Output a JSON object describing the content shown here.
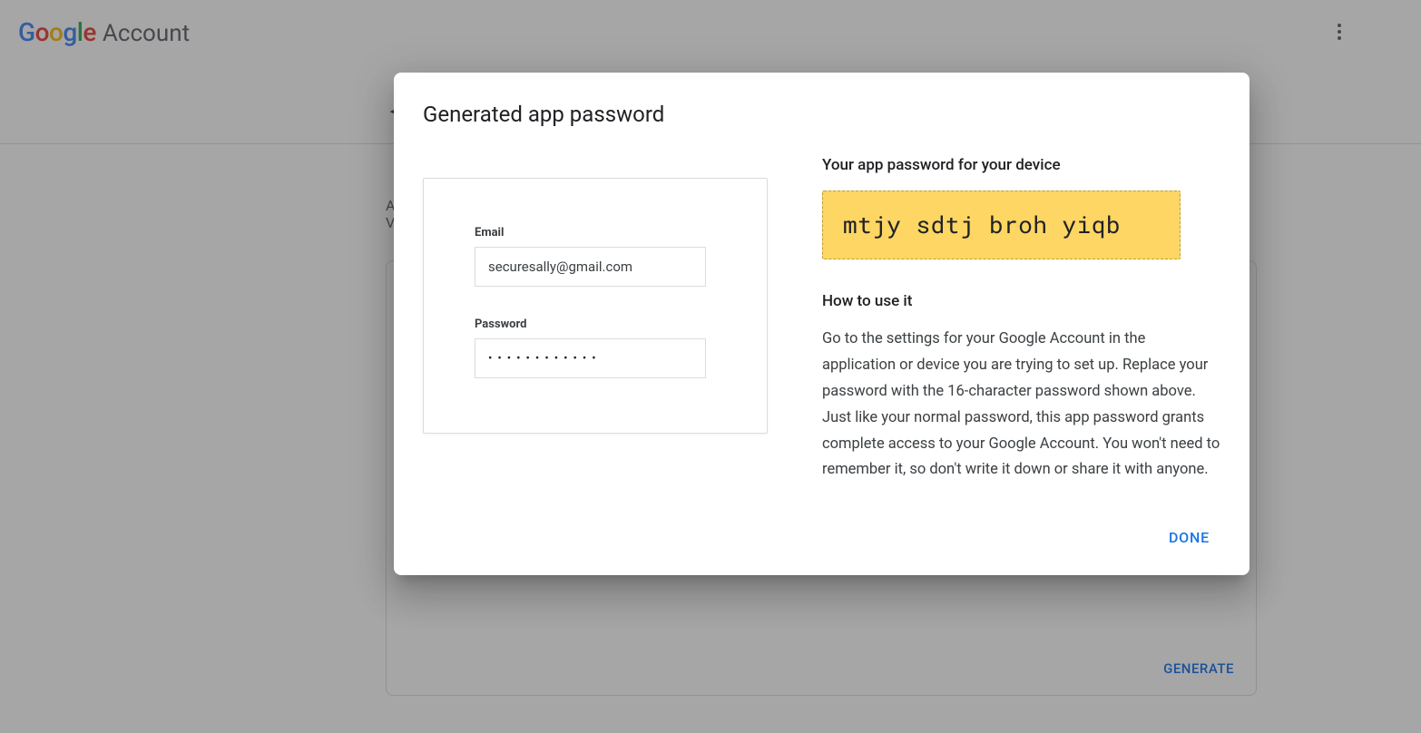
{
  "header": {
    "logo_product": "Google",
    "logo_suffix": "Account"
  },
  "background": {
    "line1": "A",
    "line2": "V",
    "generate_label": "GENERATE"
  },
  "modal": {
    "title": "Generated app password",
    "form": {
      "email_label": "Email",
      "email_value": "securesally@gmail.com",
      "password_label": "Password",
      "password_mask": "••••••••••••"
    },
    "right": {
      "heading1": "Your app password for your device",
      "generated_password": "mtjy sdtj broh yiqb",
      "heading2": "How to use it",
      "instructions": "Go to the settings for your Google Account in the application or device you are trying to set up. Replace your password with the 16-character password shown above.\nJust like your normal password, this app password grants complete access to your Google Account. You won't need to remember it, so don't write it down or share it with anyone."
    },
    "done_label": "DONE"
  }
}
